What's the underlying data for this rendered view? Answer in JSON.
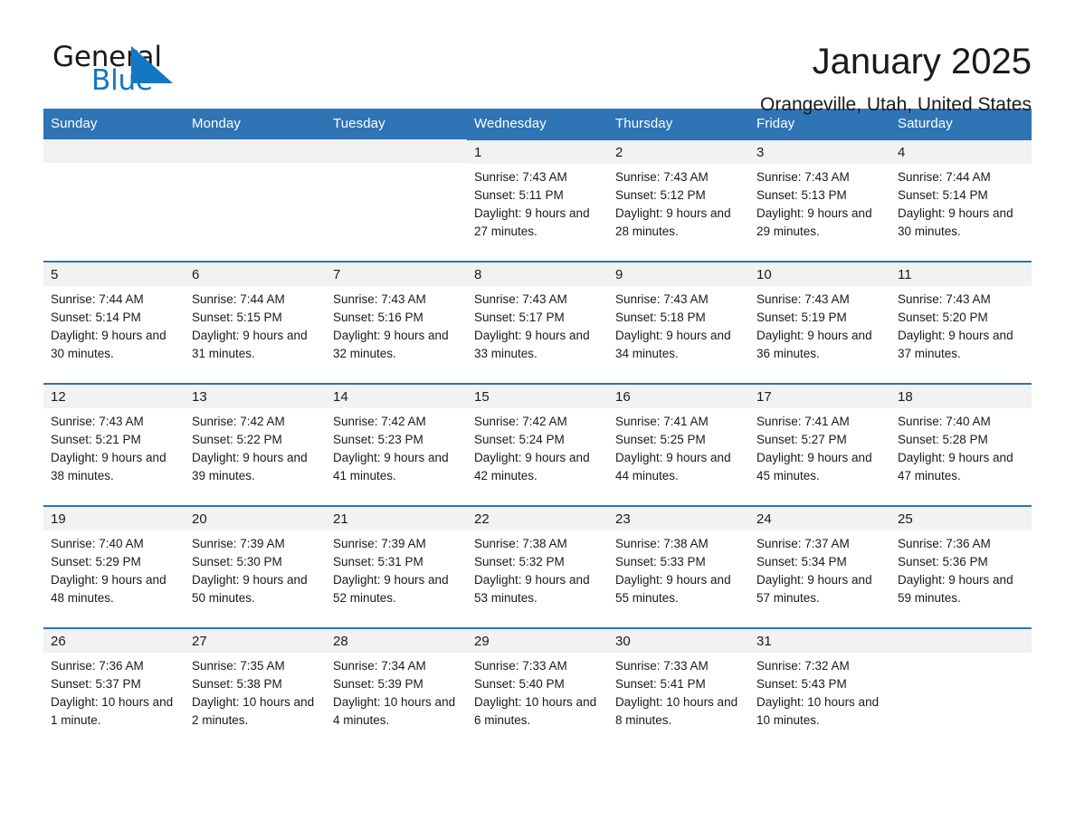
{
  "brand": {
    "name_part1": "General",
    "name_part2": "Blue",
    "triangle_color": "#1277c4"
  },
  "header": {
    "title": "January 2025",
    "subtitle": "Orangeville, Utah, United States"
  },
  "theme": {
    "header_blue": "#2f74b5",
    "daynum_band": "#f2f2f2",
    "text": "#1a1a1a"
  },
  "calendar": {
    "weekday_headers": [
      "Sunday",
      "Monday",
      "Tuesday",
      "Wednesday",
      "Thursday",
      "Friday",
      "Saturday"
    ],
    "weeks": [
      [
        {
          "day": "",
          "sunrise": "",
          "sunset": "",
          "daylight": "",
          "blank": true
        },
        {
          "day": "",
          "sunrise": "",
          "sunset": "",
          "daylight": "",
          "blank": true
        },
        {
          "day": "",
          "sunrise": "",
          "sunset": "",
          "daylight": "",
          "blank": true
        },
        {
          "day": "1",
          "sunrise": "Sunrise: 7:43 AM",
          "sunset": "Sunset: 5:11 PM",
          "daylight": "Daylight: 9 hours and 27 minutes."
        },
        {
          "day": "2",
          "sunrise": "Sunrise: 7:43 AM",
          "sunset": "Sunset: 5:12 PM",
          "daylight": "Daylight: 9 hours and 28 minutes."
        },
        {
          "day": "3",
          "sunrise": "Sunrise: 7:43 AM",
          "sunset": "Sunset: 5:13 PM",
          "daylight": "Daylight: 9 hours and 29 minutes."
        },
        {
          "day": "4",
          "sunrise": "Sunrise: 7:44 AM",
          "sunset": "Sunset: 5:14 PM",
          "daylight": "Daylight: 9 hours and 30 minutes."
        }
      ],
      [
        {
          "day": "5",
          "sunrise": "Sunrise: 7:44 AM",
          "sunset": "Sunset: 5:14 PM",
          "daylight": "Daylight: 9 hours and 30 minutes."
        },
        {
          "day": "6",
          "sunrise": "Sunrise: 7:44 AM",
          "sunset": "Sunset: 5:15 PM",
          "daylight": "Daylight: 9 hours and 31 minutes."
        },
        {
          "day": "7",
          "sunrise": "Sunrise: 7:43 AM",
          "sunset": "Sunset: 5:16 PM",
          "daylight": "Daylight: 9 hours and 32 minutes."
        },
        {
          "day": "8",
          "sunrise": "Sunrise: 7:43 AM",
          "sunset": "Sunset: 5:17 PM",
          "daylight": "Daylight: 9 hours and 33 minutes."
        },
        {
          "day": "9",
          "sunrise": "Sunrise: 7:43 AM",
          "sunset": "Sunset: 5:18 PM",
          "daylight": "Daylight: 9 hours and 34 minutes."
        },
        {
          "day": "10",
          "sunrise": "Sunrise: 7:43 AM",
          "sunset": "Sunset: 5:19 PM",
          "daylight": "Daylight: 9 hours and 36 minutes."
        },
        {
          "day": "11",
          "sunrise": "Sunrise: 7:43 AM",
          "sunset": "Sunset: 5:20 PM",
          "daylight": "Daylight: 9 hours and 37 minutes."
        }
      ],
      [
        {
          "day": "12",
          "sunrise": "Sunrise: 7:43 AM",
          "sunset": "Sunset: 5:21 PM",
          "daylight": "Daylight: 9 hours and 38 minutes."
        },
        {
          "day": "13",
          "sunrise": "Sunrise: 7:42 AM",
          "sunset": "Sunset: 5:22 PM",
          "daylight": "Daylight: 9 hours and 39 minutes."
        },
        {
          "day": "14",
          "sunrise": "Sunrise: 7:42 AM",
          "sunset": "Sunset: 5:23 PM",
          "daylight": "Daylight: 9 hours and 41 minutes."
        },
        {
          "day": "15",
          "sunrise": "Sunrise: 7:42 AM",
          "sunset": "Sunset: 5:24 PM",
          "daylight": "Daylight: 9 hours and 42 minutes."
        },
        {
          "day": "16",
          "sunrise": "Sunrise: 7:41 AM",
          "sunset": "Sunset: 5:25 PM",
          "daylight": "Daylight: 9 hours and 44 minutes."
        },
        {
          "day": "17",
          "sunrise": "Sunrise: 7:41 AM",
          "sunset": "Sunset: 5:27 PM",
          "daylight": "Daylight: 9 hours and 45 minutes."
        },
        {
          "day": "18",
          "sunrise": "Sunrise: 7:40 AM",
          "sunset": "Sunset: 5:28 PM",
          "daylight": "Daylight: 9 hours and 47 minutes."
        }
      ],
      [
        {
          "day": "19",
          "sunrise": "Sunrise: 7:40 AM",
          "sunset": "Sunset: 5:29 PM",
          "daylight": "Daylight: 9 hours and 48 minutes."
        },
        {
          "day": "20",
          "sunrise": "Sunrise: 7:39 AM",
          "sunset": "Sunset: 5:30 PM",
          "daylight": "Daylight: 9 hours and 50 minutes."
        },
        {
          "day": "21",
          "sunrise": "Sunrise: 7:39 AM",
          "sunset": "Sunset: 5:31 PM",
          "daylight": "Daylight: 9 hours and 52 minutes."
        },
        {
          "day": "22",
          "sunrise": "Sunrise: 7:38 AM",
          "sunset": "Sunset: 5:32 PM",
          "daylight": "Daylight: 9 hours and 53 minutes."
        },
        {
          "day": "23",
          "sunrise": "Sunrise: 7:38 AM",
          "sunset": "Sunset: 5:33 PM",
          "daylight": "Daylight: 9 hours and 55 minutes."
        },
        {
          "day": "24",
          "sunrise": "Sunrise: 7:37 AM",
          "sunset": "Sunset: 5:34 PM",
          "daylight": "Daylight: 9 hours and 57 minutes."
        },
        {
          "day": "25",
          "sunrise": "Sunrise: 7:36 AM",
          "sunset": "Sunset: 5:36 PM",
          "daylight": "Daylight: 9 hours and 59 minutes."
        }
      ],
      [
        {
          "day": "26",
          "sunrise": "Sunrise: 7:36 AM",
          "sunset": "Sunset: 5:37 PM",
          "daylight": "Daylight: 10 hours and 1 minute."
        },
        {
          "day": "27",
          "sunrise": "Sunrise: 7:35 AM",
          "sunset": "Sunset: 5:38 PM",
          "daylight": "Daylight: 10 hours and 2 minutes."
        },
        {
          "day": "28",
          "sunrise": "Sunrise: 7:34 AM",
          "sunset": "Sunset: 5:39 PM",
          "daylight": "Daylight: 10 hours and 4 minutes."
        },
        {
          "day": "29",
          "sunrise": "Sunrise: 7:33 AM",
          "sunset": "Sunset: 5:40 PM",
          "daylight": "Daylight: 10 hours and 6 minutes."
        },
        {
          "day": "30",
          "sunrise": "Sunrise: 7:33 AM",
          "sunset": "Sunset: 5:41 PM",
          "daylight": "Daylight: 10 hours and 8 minutes."
        },
        {
          "day": "31",
          "sunrise": "Sunrise: 7:32 AM",
          "sunset": "Sunset: 5:43 PM",
          "daylight": "Daylight: 10 hours and 10 minutes."
        },
        {
          "day": "",
          "sunrise": "",
          "sunset": "",
          "daylight": "",
          "blank": true
        }
      ]
    ]
  }
}
